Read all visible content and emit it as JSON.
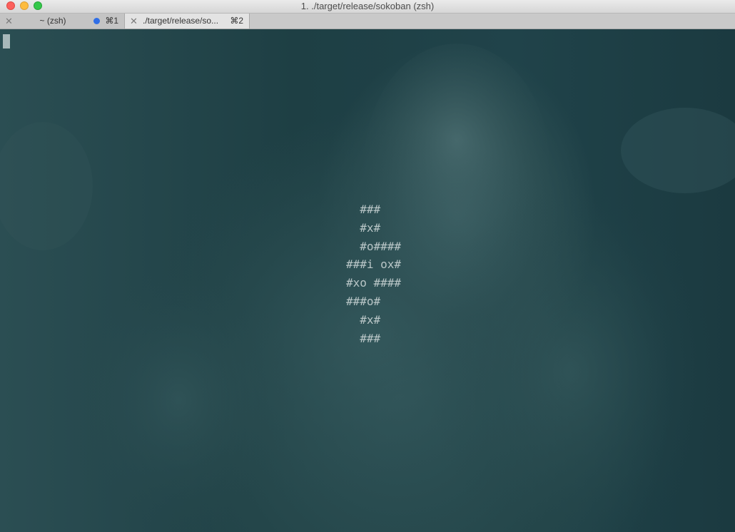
{
  "window": {
    "title": "1. ./target/release/sokoban (zsh)"
  },
  "tabs": [
    {
      "label": "~ (zsh)",
      "shortcut": "⌘1",
      "active": false
    },
    {
      "label": "./target/release/so...",
      "shortcut": "⌘2",
      "active": true
    }
  ],
  "terminal": {
    "map_lines": [
      "  ###",
      "  #x#",
      "  #o####",
      "###i ox#",
      "#xo ####",
      "###o#",
      "  #x#",
      "  ###"
    ]
  },
  "colors": {
    "tab_dot": "#2f6ee6",
    "terminal_text": "#b9c6c7",
    "terminal_bg": "#1e3f44"
  }
}
